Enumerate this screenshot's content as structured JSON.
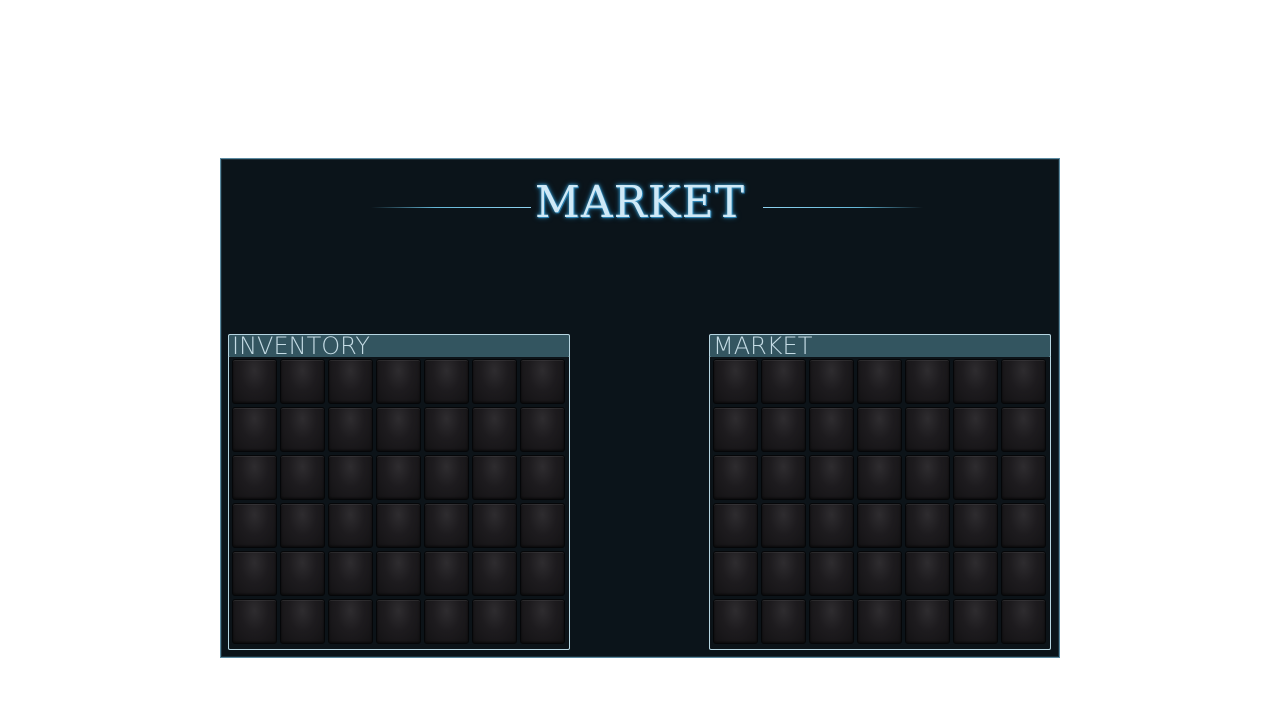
{
  "window": {
    "title": "MARKET"
  },
  "panels": {
    "inventory": {
      "label": "INVENTORY",
      "rows": 6,
      "cols": 7
    },
    "market": {
      "label": "MARKET",
      "rows": 6,
      "cols": 7
    }
  },
  "colors": {
    "window_bg": "#0b141a",
    "panel_header": "#335560",
    "title_glow": "#3da0d0",
    "slot": "#1d1b1e"
  }
}
